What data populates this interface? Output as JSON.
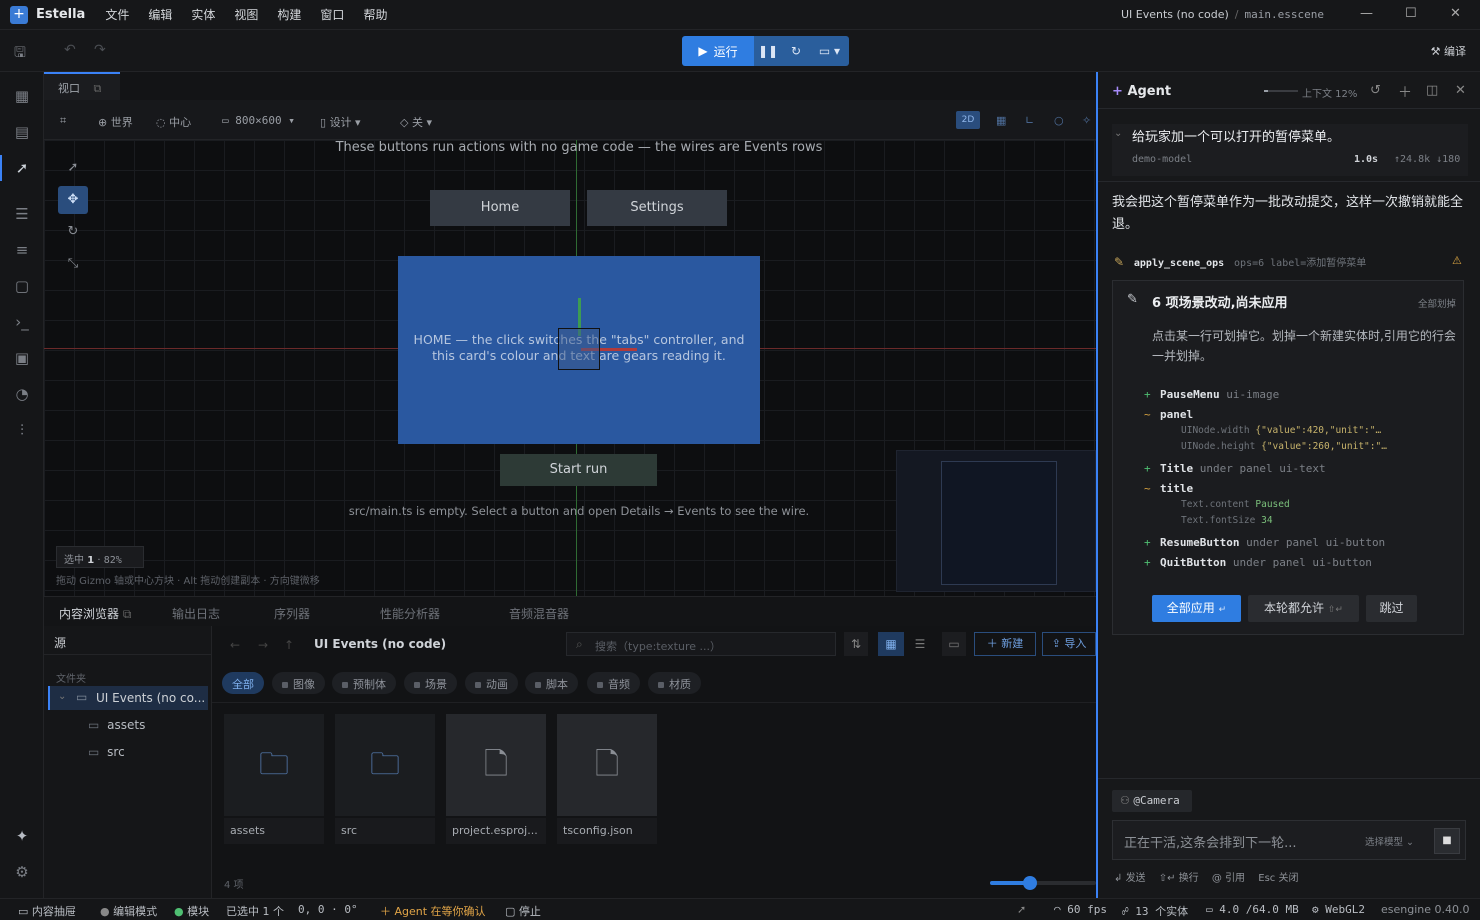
{
  "app": {
    "name": "Estella",
    "project_title": "UI Events (no code)",
    "file": "main.esscene"
  },
  "menu": [
    "文件",
    "编辑",
    "实体",
    "视图",
    "构建",
    "窗口",
    "帮助"
  ],
  "toolbar": {
    "run_label": "运行",
    "compile_label": "编译"
  },
  "viewport": {
    "tab": "视口",
    "bar": {
      "world": "世界",
      "center": "中心",
      "resolution": "800×600",
      "design": "设计",
      "off": "关",
      "mode": "2D"
    },
    "top_text": "These buttons run actions with no game code — the wires are Events rows",
    "btn_home": "Home",
    "btn_settings": "Settings",
    "card_line1": "HOME — the click switches the \"tabs\" controller, and",
    "card_line2": "this card's colour and text are gears reading it.",
    "btn_start": "Start run",
    "bottom_text": "src/main.ts is empty. Select a button and open Details → Events to see the wire.",
    "sel_info_label": "选中",
    "sel_info_count": "1",
    "sel_info_zoom": "82%",
    "hint": "拖动 Gizmo 轴或中心方块 · Alt 拖动创建副本 · 方向键微移"
  },
  "bottom": {
    "tabs": [
      "内容浏览器",
      "输出日志",
      "序列器",
      "性能分析器",
      "音频混音器"
    ],
    "source_label": "源",
    "folders_label": "文件夹",
    "tree": {
      "root": "UI Events (no co...",
      "children": [
        "assets",
        "src"
      ]
    },
    "path": "UI Events (no code)",
    "search_placeholder": "搜索（type:texture ...）",
    "new_label": "新建",
    "import_label": "导入",
    "filters": [
      "全部",
      "图像",
      "预制体",
      "场景",
      "动画",
      "脚本",
      "音频",
      "材质"
    ],
    "files": [
      {
        "name": "assets",
        "kind": "folder"
      },
      {
        "name": "src",
        "kind": "folder"
      },
      {
        "name": "project.esproj...",
        "kind": "file"
      },
      {
        "name": "tsconfig.json",
        "kind": "file"
      }
    ],
    "count": "4 项"
  },
  "agent": {
    "title": "Agent",
    "context": "上下文 12%",
    "user_msg": "给玩家加一个可以打开的暂停菜单。",
    "model": "demo-model",
    "time": "1.0s",
    "tokens": "↑24.8k ↓180",
    "reply": "我会把这个暂停菜单作为一批改动提交，这样一次撤销就能全退。",
    "tool_name": "apply_scene_ops",
    "tool_meta": "ops=6 label=添加暂停菜单",
    "ops_title": "6 项场景改动,尚未应用",
    "strike_all": "全部划掉",
    "ops_desc": "点击某一行可划掉它。划掉一个新建实体时,引用它的行会一并划掉。",
    "ops": [
      {
        "sign": "+",
        "name": "PauseMenu",
        "meta": "ui-image"
      },
      {
        "sign": "~",
        "name": "panel",
        "meta": ""
      },
      {
        "sign": "+",
        "name": "Title",
        "meta": "under panel ui-text"
      },
      {
        "sign": "~",
        "name": "title",
        "meta": ""
      },
      {
        "sign": "+",
        "name": "ResumeButton",
        "meta": "under panel ui-button"
      },
      {
        "sign": "+",
        "name": "QuitButton",
        "meta": "under panel ui-button"
      }
    ],
    "subs": {
      "w_key": "UINode.width",
      "w_val": "{\"value\":420,\"unit\":\"…",
      "h_key": "UINode.height",
      "h_val": "{\"value\":260,\"unit\":\"…",
      "tc_key": "Text.content",
      "tc_val": "Paused",
      "fs_key": "Text.fontSize",
      "fs_val": "34"
    },
    "apply_all": "全部应用",
    "allow_round": "本轮都允许",
    "skip": "跳过",
    "mention": "@Camera",
    "input_placeholder": "正在干活,这条会排到下一轮...",
    "model_select": "选择模型",
    "hint_send": "发送",
    "hint_newline": "换行",
    "hint_ref": "引用",
    "hint_esc": "Esc 关闭"
  },
  "status": {
    "content_drawer": "内容抽屉",
    "edit_mode": "编辑模式",
    "module": "模块",
    "selected": "已选中 1 个",
    "coords": "0, 0 · 0°",
    "agent_wait": "Agent 在等你确认",
    "stop": "停止",
    "fps": "60 fps",
    "entities": "13 个实体",
    "memory": "4.0 /64.0 MB",
    "renderer": "WebGL2",
    "version": "esengine 0.40.0"
  },
  "colors": {
    "accent": "#2f7de1",
    "add": "#4fbf72",
    "modify": "#d9a441",
    "card": "#2a58a0"
  }
}
